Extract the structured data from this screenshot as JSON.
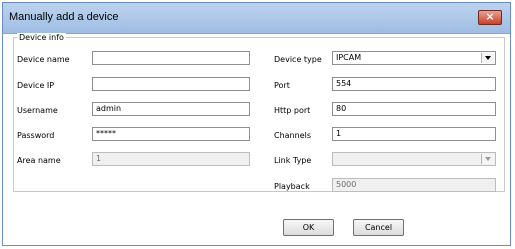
{
  "window": {
    "title": "Manually add a device",
    "close_label": "×"
  },
  "group": {
    "title": "Device info"
  },
  "fields": {
    "device_name": {
      "label": "Device name",
      "value": ""
    },
    "device_ip": {
      "label": "Device IP",
      "value": ""
    },
    "username": {
      "label": "Username",
      "value": "admin"
    },
    "password": {
      "label": "Password",
      "value": "*****"
    },
    "area_name": {
      "label": "Area name",
      "value": "1"
    },
    "device_type": {
      "label": "Device type",
      "value": "IPCAM"
    },
    "port": {
      "label": "Port",
      "value": "554"
    },
    "http_port": {
      "label": "Http port",
      "value": "80"
    },
    "channels": {
      "label": "Channels",
      "value": "1"
    },
    "link_type": {
      "label": "Link Type",
      "value": ""
    },
    "playback": {
      "label": "Playback",
      "value": "5000"
    }
  },
  "buttons": {
    "ok": "OK",
    "cancel": "Cancel"
  },
  "icons": {
    "close": "close-icon",
    "dropdown": "chevron-down-icon"
  },
  "colors": {
    "titlebar": "#9fbde3",
    "close_button": "#c8412c"
  }
}
